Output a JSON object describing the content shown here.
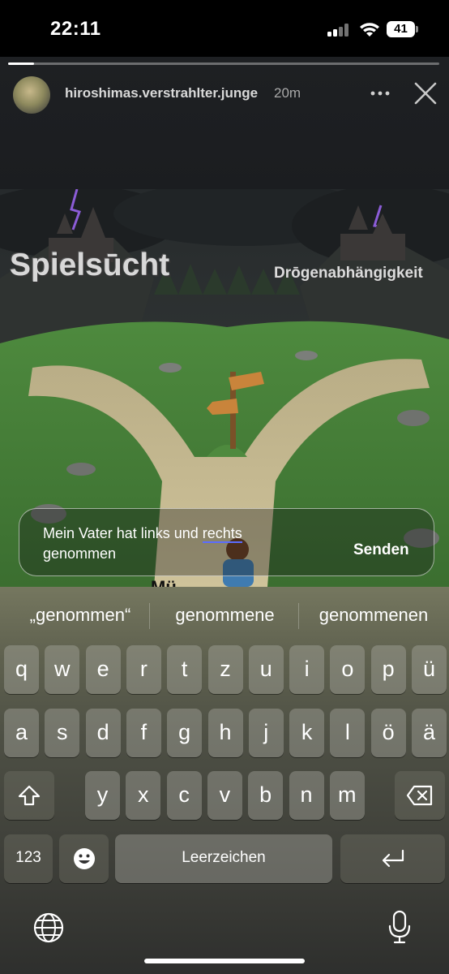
{
  "status_bar": {
    "time": "22:11",
    "battery": "41"
  },
  "story": {
    "username": "hiroshimas.verstrahlter.junge",
    "time_ago": "20m",
    "progress": 0.06,
    "image": {
      "label_left": "Spielsūcht",
      "label_right": "Drōgenabhängigkeit",
      "bottom_text": "Mü"
    }
  },
  "reply": {
    "text_before": "Mein Vater hat links und ",
    "text_autocorrect": "rechts",
    "text_after": " genommen",
    "send_label": "Senden"
  },
  "keyboard": {
    "suggestions": [
      "„genommen“",
      "genommene",
      "genommenen"
    ],
    "row1": [
      "q",
      "w",
      "e",
      "r",
      "t",
      "z",
      "u",
      "i",
      "o",
      "p",
      "ü"
    ],
    "row2": [
      "a",
      "s",
      "d",
      "f",
      "g",
      "h",
      "j",
      "k",
      "l",
      "ö",
      "ä"
    ],
    "row3": [
      "y",
      "x",
      "c",
      "v",
      "b",
      "n",
      "m"
    ],
    "numbers_label": "123",
    "space_label": "Leerzeichen",
    "icons": {
      "shift": "shift-icon",
      "delete": "delete-icon",
      "emoji": "emoji-icon",
      "return": "return-icon",
      "globe": "globe-icon",
      "mic": "microphone-icon"
    }
  }
}
